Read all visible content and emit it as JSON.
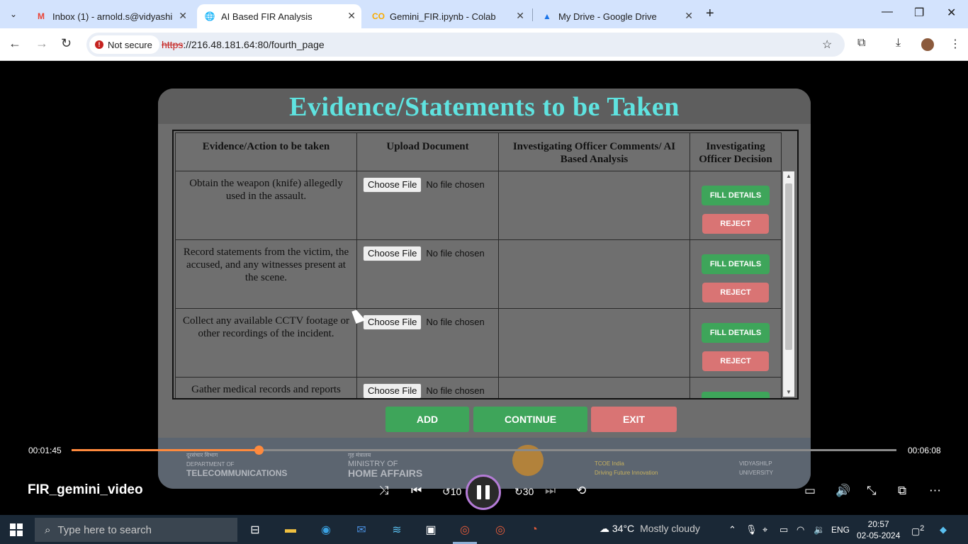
{
  "browser": {
    "tabs": [
      {
        "title": "Inbox (1) - arnold.s@vidyashilp",
        "icon": "gmail-icon",
        "active": false
      },
      {
        "title": "AI Based FIR Analysis",
        "icon": "globe-icon",
        "active": true
      },
      {
        "title": "Gemini_FIR.ipynb - Colab",
        "icon": "colab-icon",
        "active": false
      },
      {
        "title": "My Drive - Google Drive",
        "icon": "drive-icon",
        "active": false
      }
    ],
    "security_label": "Not secure",
    "url_scheme": "https",
    "url_rest": "://216.48.181.64:80/fourth_page"
  },
  "app": {
    "title": "Evidence/Statements to be Taken",
    "columns": [
      "Evidence/Action to be taken",
      "Upload Document",
      "Investigating Officer Comments/ AI Based Analysis",
      "Investigating Officer Decision"
    ],
    "rows": [
      {
        "evidence": "Obtain the weapon (knife) allegedly used in the assault.",
        "comment": ""
      },
      {
        "evidence": "Record statements from the victim, the accused, and any witnesses present at the scene.",
        "comment": ""
      },
      {
        "evidence": "Collect any available CCTV footage or other recordings of the incident.",
        "comment": ""
      },
      {
        "evidence": "Gather medical records and reports",
        "comment": ""
      }
    ],
    "choose_file_label": "Choose File",
    "no_file_label": "No file chosen",
    "fill_details_label": "FILL DETAILS",
    "reject_label": "REJECT",
    "buttons": {
      "add": "ADD",
      "continue": "CONTINUE",
      "exit": "EXIT"
    },
    "logos": [
      {
        "line1": "दूरसंचार विभाग",
        "line2": "DEPARTMENT OF",
        "line3": "TELECOMMUNICATIONS"
      },
      {
        "line1": "गृह मंत्रालय",
        "line2": "MINISTRY OF",
        "line3": "HOME AFFAIRS"
      },
      {
        "line1": "",
        "line2": "",
        "line3": ""
      },
      {
        "line1": "TCOE India",
        "line2": "Driving Future Innovation",
        "line3": ""
      },
      {
        "line1": "",
        "line2": "VIDYASHILP",
        "line3": "UNIVERSITY"
      }
    ],
    "colors": {
      "title": "#5fe3e0",
      "fill": "#3ea55a",
      "reject": "#d97474",
      "panel": "#6d6d6d"
    }
  },
  "player": {
    "current_time": "00:01:45",
    "total_time": "00:06:08",
    "progress": 0.227,
    "video_title": "FIR_gemini_video",
    "accent": "#ff8a3d"
  },
  "taskbar": {
    "search_placeholder": "Type here to search",
    "temperature": "34°C",
    "weather": "Mostly cloudy",
    "language": "ENG",
    "time": "20:57",
    "date": "02-05-2024",
    "notifications": "2"
  }
}
